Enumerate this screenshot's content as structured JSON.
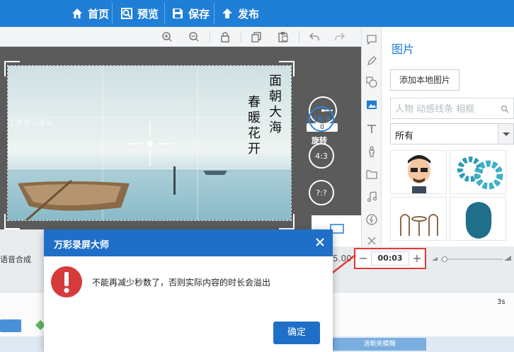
{
  "topbar": {
    "items": [
      {
        "label": "首页",
        "icon": "home-icon"
      },
      {
        "label": "预览",
        "icon": "preview-icon"
      },
      {
        "label": "保存",
        "icon": "save-icon"
      },
      {
        "label": "发布",
        "icon": "publish-icon"
      }
    ],
    "color": "#1f7ed6"
  },
  "toolbar": {
    "icons": [
      "zoom-in-icon",
      "zoom-out-icon",
      "lock-icon",
      "copy-icon",
      "paste-icon",
      "undo-icon",
      "redo-icon"
    ]
  },
  "canvas": {
    "camera_label": "默认镜头",
    "poem_right": "面朝大海",
    "poem_left": "春暖花开"
  },
  "rotate": {
    "value": "0",
    "label": "旋转"
  },
  "ratios": [
    {
      "label": "16:9",
      "active": true
    },
    {
      "label": "4:3",
      "active": false
    },
    {
      "label": "?:?",
      "active": false
    }
  ],
  "side_icons": [
    "chat-icon",
    "pen-icon",
    "shapes-icon",
    "image-icon",
    "text-icon",
    "person-icon",
    "folder-icon",
    "music-icon",
    "flash-icon",
    "more-icon"
  ],
  "panel": {
    "title": "图片",
    "add_button": "添加本地图片",
    "search_placeholder": "人物 动感线条 相框",
    "category_selected": "所有"
  },
  "bottom": {
    "tts_label": "语音合成",
    "time_partial": "5.00",
    "duration_value": "00:03",
    "minus": "−",
    "plus": "+",
    "ruler_mark": "3s",
    "track_label": "清新夹模糊"
  },
  "dialog": {
    "title": "万彩录屏大师",
    "message": "不能再减少秒数了，否则实际内容的时长会溢出",
    "ok_label": "确定",
    "accent": "#1f6fc8",
    "warn_color": "#d63b3b"
  }
}
